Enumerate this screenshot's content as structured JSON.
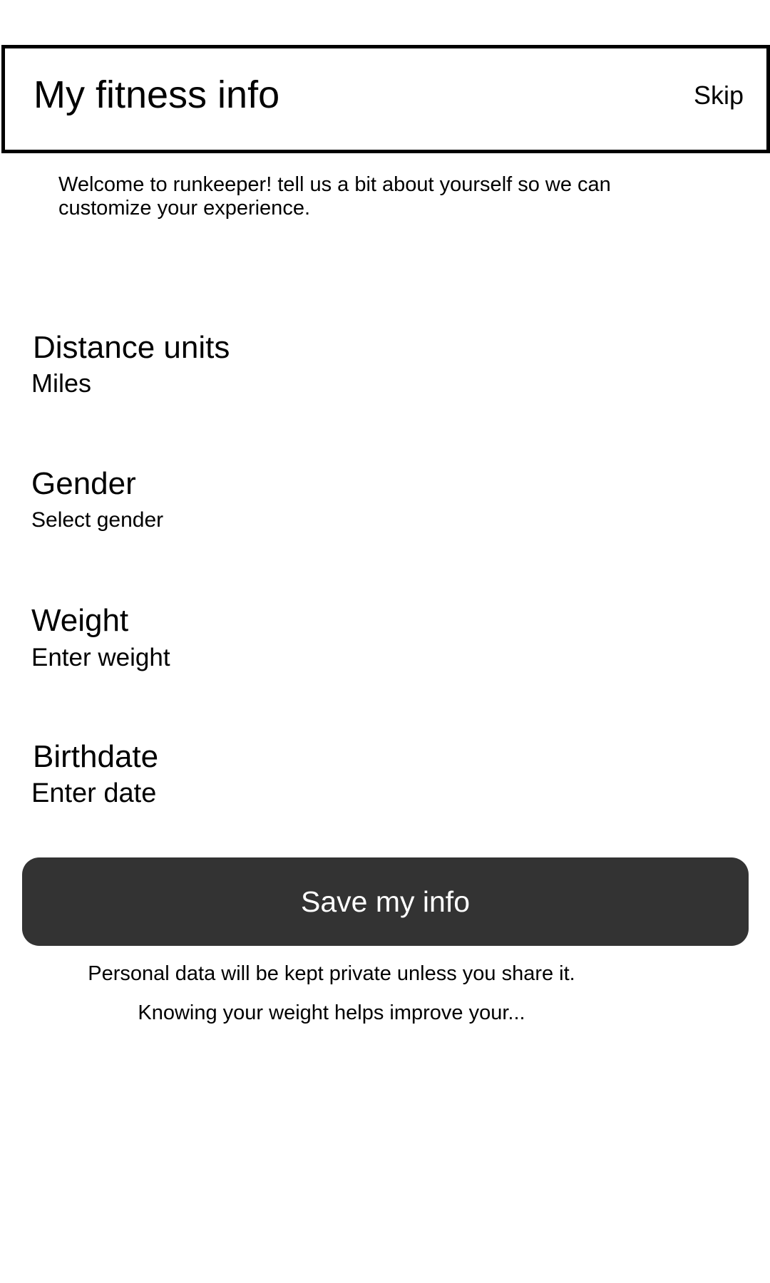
{
  "header": {
    "title": "My fitness info",
    "skip_label": "Skip"
  },
  "welcome_text": "Welcome to runkeeper! tell us a bit about yourself so we can customize your experience.",
  "fields": {
    "distance_units": {
      "label": "Distance units",
      "value": "Miles"
    },
    "gender": {
      "label": "Gender",
      "value": "Select gender"
    },
    "weight": {
      "label": "Weight",
      "value": "Enter weight"
    },
    "birthdate": {
      "label": "Birthdate",
      "value": "Enter date"
    }
  },
  "save_button_label": "Save my info",
  "footnotes": {
    "privacy": "Personal data will be kept private unless you share it.",
    "weight_hint": "Knowing your weight helps improve your..."
  },
  "colors": {
    "button_background": "#333333",
    "button_text": "#ffffff",
    "border": "#000000"
  }
}
